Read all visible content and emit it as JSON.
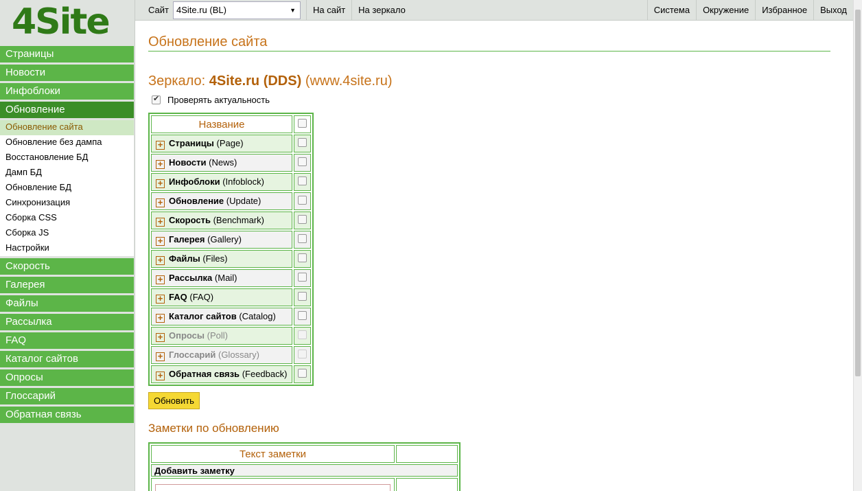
{
  "logo": "4Site",
  "sidebar": {
    "menu_before": [
      {
        "label": "Страницы"
      },
      {
        "label": "Новости"
      },
      {
        "label": "Инфоблоки"
      },
      {
        "label": "Обновление"
      }
    ],
    "submenu": [
      {
        "label": "Обновление сайта"
      },
      {
        "label": "Обновление без дампа"
      },
      {
        "label": "Восстановление БД"
      },
      {
        "label": "Дамп БД"
      },
      {
        "label": "Обновление БД"
      },
      {
        "label": "Синхронизация"
      },
      {
        "label": "Сборка CSS"
      },
      {
        "label": "Сборка JS"
      },
      {
        "label": "Настройки"
      }
    ],
    "menu_after": [
      {
        "label": "Скорость"
      },
      {
        "label": "Галерея"
      },
      {
        "label": "Файлы"
      },
      {
        "label": "Рассылка"
      },
      {
        "label": "FAQ"
      },
      {
        "label": "Каталог сайтов"
      },
      {
        "label": "Опросы"
      },
      {
        "label": "Глоссарий"
      },
      {
        "label": "Обратная связь"
      }
    ]
  },
  "topbar": {
    "site_label": "Сайт",
    "site_value": "4Site.ru (BL)",
    "to_site": "На сайт",
    "to_mirror": "На зеркало",
    "system": "Система",
    "environment": "Окружение",
    "favorites": "Избранное",
    "logout": "Выход"
  },
  "content": {
    "title": "Обновление сайта",
    "mirror_prefix": "Зеркало:",
    "mirror_name": "4Site.ru (DDS)",
    "mirror_url": "(www.4site.ru)",
    "check_actual": "Проверять актуальность",
    "table_header": "Название",
    "modules": [
      {
        "name": "Страницы",
        "code": "(Page)"
      },
      {
        "name": "Новости",
        "code": "(News)"
      },
      {
        "name": "Инфоблоки",
        "code": "(Infoblock)"
      },
      {
        "name": "Обновление",
        "code": "(Update)"
      },
      {
        "name": "Скорость",
        "code": "(Benchmark)"
      },
      {
        "name": "Галерея",
        "code": "(Gallery)"
      },
      {
        "name": "Файлы",
        "code": "(Files)"
      },
      {
        "name": "Рассылка",
        "code": "(Mail)"
      },
      {
        "name": "FAQ",
        "code": "(FAQ)"
      },
      {
        "name": "Каталог сайтов",
        "code": "(Catalog)"
      },
      {
        "name": "Опросы",
        "code": "(Poll)",
        "disabled": true
      },
      {
        "name": "Глоссарий",
        "code": "(Glossary)",
        "disabled": true
      },
      {
        "name": "Обратная связь",
        "code": "(Feedback)"
      }
    ],
    "update_button": "Обновить",
    "notes_title": "Заметки по обновлению",
    "notes_header": "Текст заметки",
    "add_note": "Добавить заметку"
  },
  "colors": {
    "accent_green": "#5cb548",
    "active_green": "#3b8e28",
    "title_orange": "#c7731a",
    "button_yellow": "#f5d834"
  }
}
